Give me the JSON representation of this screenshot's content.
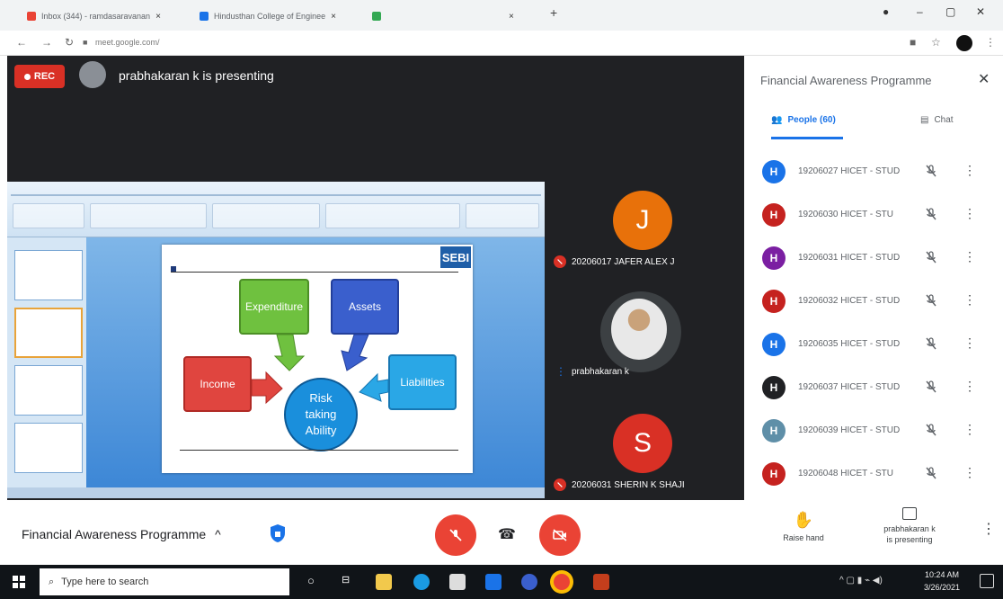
{
  "browser": {
    "tabs": [
      {
        "label": "Inbox (344) - ramdasaravanan"
      },
      {
        "label": "Hindusthan College of Enginee"
      },
      {
        "label": ""
      }
    ],
    "url": "meet.google.com/"
  },
  "stage": {
    "rec_label": "REC",
    "presenting_text": "prabhakaran k is presenting"
  },
  "slide": {
    "logo_text": "SEBI",
    "boxes": {
      "expenditure": "Expenditure",
      "assets": "Assets",
      "income": "Income",
      "liabilities": "Liabilities"
    },
    "center": [
      "Risk",
      "taking",
      "Ability"
    ]
  },
  "tiles": [
    {
      "initial": "J",
      "name": "20206017 JAFER ALEX J",
      "color": "#e8710a"
    },
    {
      "initial": "",
      "name": "prabhakaran k",
      "color": "#3c4043"
    },
    {
      "initial": "S",
      "name": "20206031 SHERIN K SHAJI",
      "color": "#d93025"
    }
  ],
  "panel": {
    "title": "Financial Awareness Programme",
    "people_tab": "People (60)",
    "chat_tab": "Chat",
    "participants": [
      {
        "initial": "H",
        "name": "19206027 HICET - STUD",
        "color": "#1a73e8"
      },
      {
        "initial": "H",
        "name": "19206030 HICET - STU",
        "color": "#c5221f"
      },
      {
        "initial": "H",
        "name": "19206031 HICET - STUD",
        "color": "#7b1fa2"
      },
      {
        "initial": "H",
        "name": "19206032 HICET - STUD",
        "color": "#c5221f"
      },
      {
        "initial": "H",
        "name": "19206035 HICET - STUD",
        "color": "#1a73e8"
      },
      {
        "initial": "H",
        "name": "19206037 HICET - STUD",
        "color": "#202124"
      },
      {
        "initial": "H",
        "name": "19206039 HICET - STUD",
        "color": "#5f8fa8"
      },
      {
        "initial": "H",
        "name": "19206048 HICET - STU",
        "color": "#c5221f"
      }
    ]
  },
  "bottom": {
    "meeting_title": "Financial Awareness Programme",
    "raise_hand": "Raise hand",
    "presenting_line1": "prabhakaran k",
    "presenting_line2": "is presenting"
  },
  "taskbar": {
    "search_placeholder": "Type here to search",
    "time": "10:24 AM",
    "date": "3/26/2021"
  }
}
